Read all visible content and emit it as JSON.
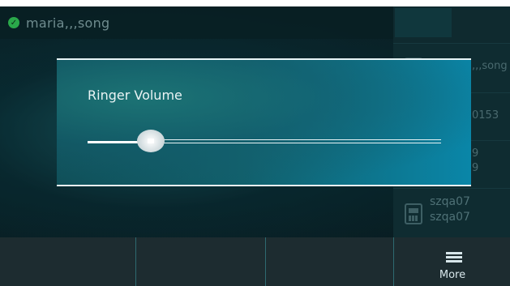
{
  "header": {
    "contact_name": "maria,,,song",
    "status_icon": "presence-available-icon"
  },
  "right_panel": {
    "tab_label": "",
    "rows": [
      {
        "text": ",,,song"
      },
      {
        "text": "0153"
      },
      {
        "line1": "9",
        "line2": "9"
      },
      {
        "line1": "szqa07",
        "line2": "szqa07"
      }
    ]
  },
  "dialog": {
    "title": "Ringer Volume",
    "volume_fraction": 0.18
  },
  "softkeys": {
    "more_label": "More",
    "more_icon": "menu-list-icon"
  },
  "colors": {
    "accent": "#0a86a8",
    "presence": "#2aa84a"
  }
}
